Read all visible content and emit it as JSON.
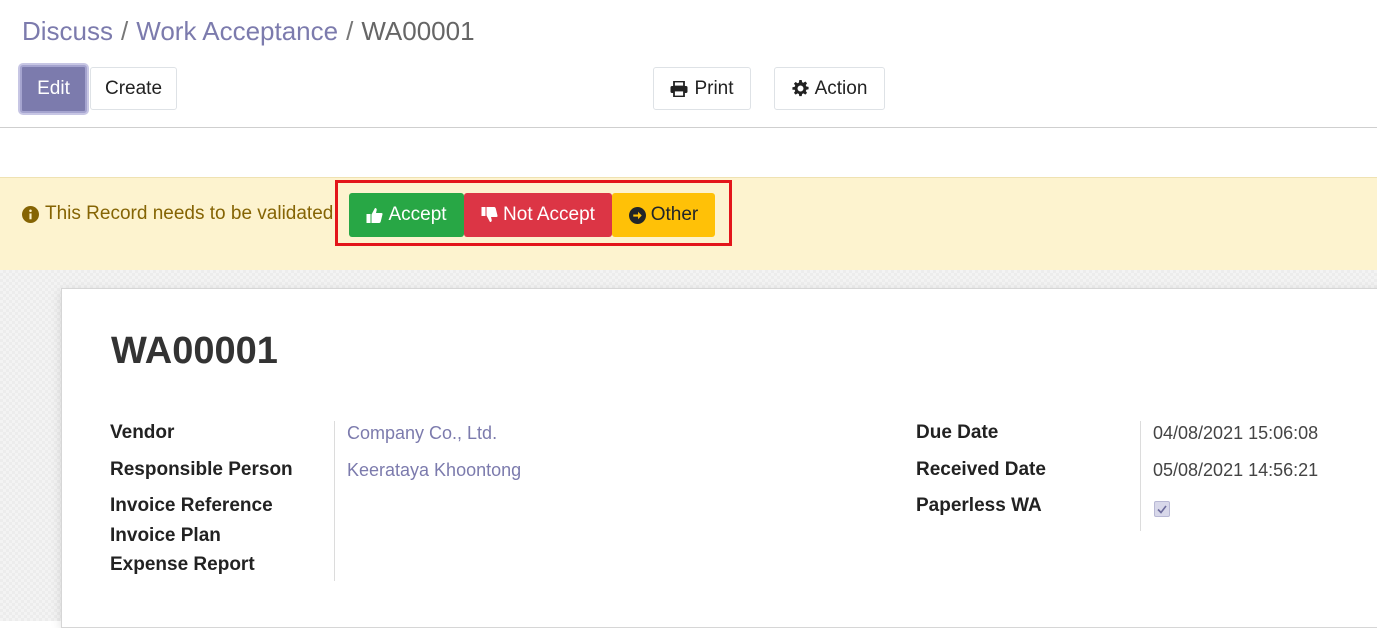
{
  "breadcrumb": {
    "items": [
      "Discuss",
      "Work Acceptance"
    ],
    "current": "WA00001",
    "separator": "/"
  },
  "toolbar": {
    "edit_label": "Edit",
    "create_label": "Create",
    "print_label": "Print",
    "action_label": "Action"
  },
  "alert": {
    "message": "This Record needs to be validated.",
    "accept_label": "Accept",
    "not_accept_label": "Not Accept",
    "other_label": "Other"
  },
  "record": {
    "title": "WA00001",
    "left_fields": [
      {
        "label": "Vendor",
        "value": "Company Co., Ltd."
      },
      {
        "label": "Responsible Person",
        "value": "Keerataya Khoontong"
      },
      {
        "label": "Invoice Reference",
        "value": ""
      },
      {
        "label": "Invoice Plan",
        "value": ""
      },
      {
        "label": "Expense Report",
        "value": ""
      }
    ],
    "right_fields": [
      {
        "label": "Due Date",
        "value": "04/08/2021 15:06:08"
      },
      {
        "label": "Received Date",
        "value": "05/08/2021 14:56:21"
      },
      {
        "label": "Paperless WA",
        "checked": true
      }
    ]
  },
  "colors": {
    "accent": "#7c7bad",
    "success": "#28a745",
    "danger": "#dc3545",
    "warning": "#ffc107",
    "highlight": "#e3151a"
  },
  "icons": [
    "print-icon",
    "gear-icon",
    "info-icon",
    "thumbs-up-icon",
    "thumbs-down-icon",
    "arrow-circle-right-icon",
    "check-icon"
  ]
}
